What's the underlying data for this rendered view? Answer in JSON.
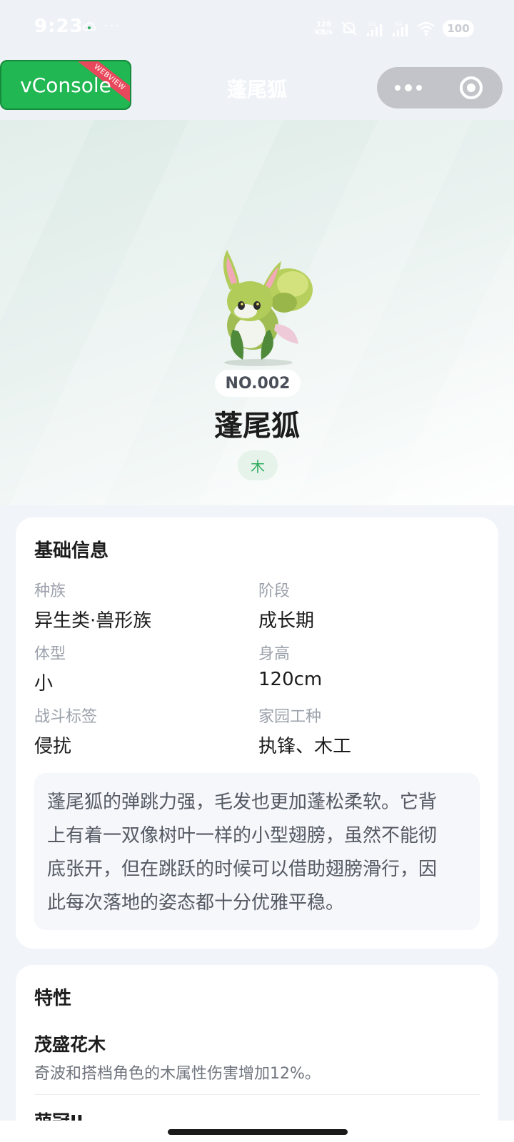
{
  "status_bar": {
    "time": "9:23",
    "more": "···",
    "net_speed_top": "128",
    "net_speed_bottom": "KB/s",
    "sig1_label": "5G",
    "sig2_label": "5G",
    "battery": "100",
    "icons": [
      "cloud-icon",
      "mute-icon",
      "signal-icon",
      "signal-icon",
      "wifi-icon",
      "battery-icon"
    ]
  },
  "vconsole": {
    "label": "vConsole",
    "ribbon": "WEBVIEW",
    "bg_color": "#21b752",
    "ribbon_color": "#e8485c"
  },
  "nav": {
    "title": "蓬尾狐",
    "capsule_icons": [
      "more-icon",
      "close-target-icon"
    ]
  },
  "pet": {
    "number": "NO.002",
    "name": "蓬尾狐",
    "element": "木",
    "element_color": "#2fae5f",
    "image": "fox-creature-image"
  },
  "basic_info": {
    "title": "基础信息",
    "fields": [
      {
        "label": "种族",
        "value": "异生类·兽形族"
      },
      {
        "label": "阶段",
        "value": "成长期"
      },
      {
        "label": "体型",
        "value": "小"
      },
      {
        "label": "身高",
        "value": "120cm"
      },
      {
        "label": "战斗标签",
        "value": "侵扰"
      },
      {
        "label": "家园工种",
        "value": "执锋、木工"
      }
    ],
    "description_lines": [
      "蓬尾狐的弹跳力强，毛发也更加蓬松柔软。它背",
      "上有着一双像树叶一样的小型翅膀，虽然不能彻",
      "底张开，但在跳跃的时候可以借助翅膀滑行，因",
      "此每次落地的姿态都十分优雅平稳。"
    ]
  },
  "traits": {
    "title": "特性",
    "items": [
      {
        "name": "茂盛花木",
        "desc": "奇波和搭档角色的木属性伤害增加12%。"
      },
      {
        "name": "萌冠II",
        "desc": ""
      }
    ]
  }
}
